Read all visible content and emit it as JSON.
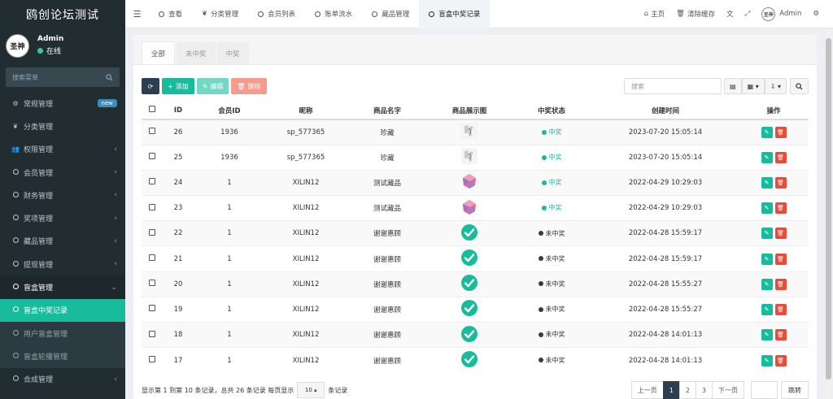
{
  "app": {
    "title": "鸥创论坛测试"
  },
  "user": {
    "name": "Admin",
    "status": "在线",
    "avatar_text": "圣神"
  },
  "sidebar": {
    "search_placeholder": "搜索菜单",
    "items": [
      {
        "label": "常规管理",
        "icon": "cogs-icon",
        "badge": "new",
        "arrow": ""
      },
      {
        "label": "分类管理",
        "icon": "leaf-icon",
        "badge": "",
        "arrow": ""
      },
      {
        "label": "权限管理",
        "icon": "group-icon",
        "badge": "",
        "arrow": "‹"
      },
      {
        "label": "会员管理",
        "icon": "circle-icon",
        "badge": "",
        "arrow": "‹"
      },
      {
        "label": "财务管理",
        "icon": "circle-icon",
        "badge": "",
        "arrow": "‹"
      },
      {
        "label": "奖项管理",
        "icon": "circle-icon",
        "badge": "",
        "arrow": "‹"
      },
      {
        "label": "藏品管理",
        "icon": "circle-icon",
        "badge": "",
        "arrow": "‹"
      },
      {
        "label": "提现管理",
        "icon": "circle-icon",
        "badge": "",
        "arrow": "‹"
      },
      {
        "label": "盲盒管理",
        "icon": "circle-icon",
        "badge": "",
        "arrow": "⌄"
      },
      {
        "label": "盲盒中奖记录",
        "icon": "circle-icon",
        "badge": "",
        "arrow": ""
      },
      {
        "label": "用户盲盒管理",
        "icon": "circle-icon",
        "badge": "",
        "arrow": ""
      },
      {
        "label": "盲盒轮播管理",
        "icon": "circle-icon",
        "badge": "",
        "arrow": ""
      },
      {
        "label": "合成管理",
        "icon": "circle-icon",
        "badge": "",
        "arrow": "‹"
      }
    ]
  },
  "topbar": {
    "tabs": [
      {
        "label": "查看"
      },
      {
        "label": "分类管理"
      },
      {
        "label": "会员列表"
      },
      {
        "label": "账单流水"
      },
      {
        "label": "藏品管理"
      },
      {
        "label": "盲盒中奖记录"
      }
    ],
    "home": "主页",
    "clear_cache": "清除缓存",
    "user": "Admin"
  },
  "panel": {
    "tabs": [
      "全部",
      "未中奖",
      "中奖"
    ]
  },
  "toolbar": {
    "add": "添加",
    "edit": "编辑",
    "delete": "删除",
    "search_placeholder": "搜索"
  },
  "table": {
    "headers": [
      "ID",
      "会员ID",
      "昵称",
      "商品名字",
      "商品展示图",
      "中奖状态",
      "创建时间",
      "操作"
    ],
    "rows": [
      {
        "id": "26",
        "member_id": "1936",
        "nickname": "sp_577365",
        "goods": "珍藏",
        "image": "figurine",
        "status": "中奖",
        "won": true,
        "created": "2023-07-20 15:05:14"
      },
      {
        "id": "25",
        "member_id": "1936",
        "nickname": "sp_577365",
        "goods": "珍藏",
        "image": "figurine",
        "status": "中奖",
        "won": true,
        "created": "2023-07-20 15:05:14"
      },
      {
        "id": "24",
        "member_id": "1",
        "nickname": "XILIN12",
        "goods": "测试藏品",
        "image": "gem",
        "status": "中奖",
        "won": true,
        "created": "2022-04-29 10:29:03"
      },
      {
        "id": "23",
        "member_id": "1",
        "nickname": "XILIN12",
        "goods": "测试藏品",
        "image": "gem",
        "status": "中奖",
        "won": true,
        "created": "2022-04-29 10:29:03"
      },
      {
        "id": "22",
        "member_id": "1",
        "nickname": "XILIN12",
        "goods": "谢谢惠顾",
        "image": "check",
        "status": "未中奖",
        "won": false,
        "created": "2022-04-28 15:59:17"
      },
      {
        "id": "21",
        "member_id": "1",
        "nickname": "XILIN12",
        "goods": "谢谢惠顾",
        "image": "check",
        "status": "未中奖",
        "won": false,
        "created": "2022-04-28 15:59:17"
      },
      {
        "id": "20",
        "member_id": "1",
        "nickname": "XILIN12",
        "goods": "谢谢惠顾",
        "image": "check",
        "status": "未中奖",
        "won": false,
        "created": "2022-04-28 15:55:27"
      },
      {
        "id": "19",
        "member_id": "1",
        "nickname": "XILIN12",
        "goods": "谢谢惠顾",
        "image": "check",
        "status": "未中奖",
        "won": false,
        "created": "2022-04-28 15:55:27"
      },
      {
        "id": "18",
        "member_id": "1",
        "nickname": "XILIN12",
        "goods": "谢谢惠顾",
        "image": "check",
        "status": "未中奖",
        "won": false,
        "created": "2022-04-28 14:01:13"
      },
      {
        "id": "17",
        "member_id": "1",
        "nickname": "XILIN12",
        "goods": "谢谢惠顾",
        "image": "check",
        "status": "未中奖",
        "won": false,
        "created": "2022-04-28 14:01:13"
      }
    ]
  },
  "footer": {
    "summary": "显示第 1 到第 10 条记录，总共 26 条记录 每页显示",
    "page_size": "10",
    "suffix": "条记录",
    "prev": "上一页",
    "pages": [
      "1",
      "2",
      "3"
    ],
    "current_page": "1",
    "next": "下一页",
    "jump": "跳转"
  },
  "colors": {
    "primary": "#18bc9c",
    "danger": "#e74c3c",
    "sidebar": "#222d32",
    "dark": "#2c3e50"
  }
}
